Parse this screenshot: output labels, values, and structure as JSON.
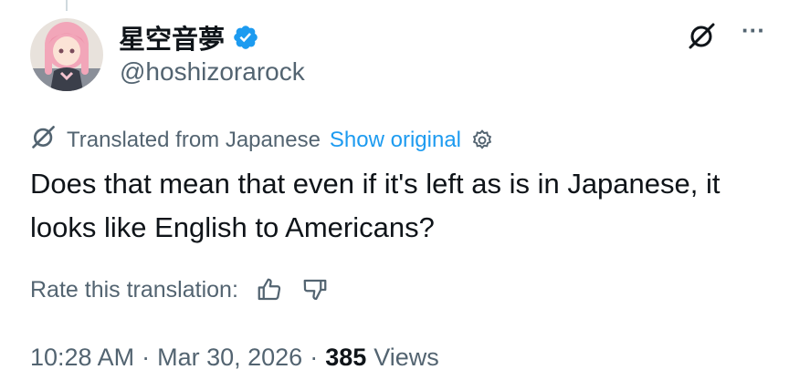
{
  "author": {
    "display_name": "星空音夢",
    "handle": "@hoshizorarock",
    "verified": true
  },
  "header_actions": {
    "grok_icon": "grok-slash-icon",
    "more_label": "···"
  },
  "translation": {
    "translated_label": "Translated from Japanese",
    "show_original_label": "Show original",
    "settings_icon": "gear-icon"
  },
  "tweet": {
    "text": "Does that mean that even if it's left as is in Japanese, it looks like English to Americans?"
  },
  "rating": {
    "label": "Rate this translation:",
    "thumbs_up_icon": "thumbs-up-icon",
    "thumbs_down_icon": "thumbs-down-icon"
  },
  "meta": {
    "time": "10:28 AM",
    "separator": "·",
    "date": "Mar 30, 2026",
    "views_count": "385",
    "views_label": "Views"
  },
  "colors": {
    "text_primary": "#0f1419",
    "text_secondary": "#536471",
    "accent": "#1d9bf0"
  }
}
